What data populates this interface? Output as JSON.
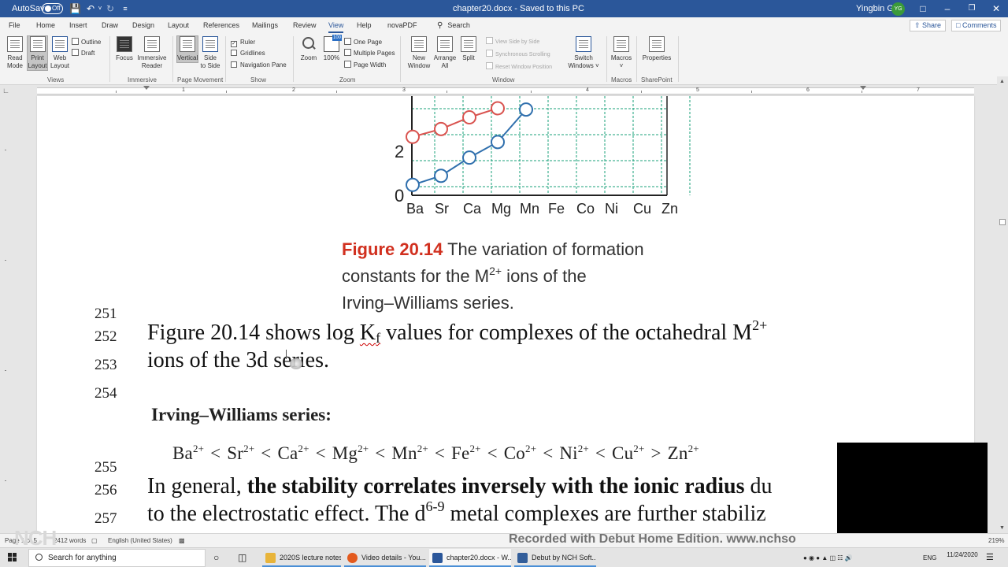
{
  "titlebar": {
    "autosave_label": "AutoSave",
    "autosave_state": "Off",
    "doc_title": "chapter20.docx  -  Saved to this PC",
    "user_name": "Yingbin Ge",
    "user_initials": "YG"
  },
  "tabs": [
    "File",
    "Home",
    "Insert",
    "Draw",
    "Design",
    "Layout",
    "References",
    "Mailings",
    "Review",
    "View",
    "Help",
    "novaPDF"
  ],
  "active_tab": "View",
  "search_label": "Search",
  "share_label": "Share",
  "comments_label": "Comments",
  "ribbon": {
    "views": {
      "read_mode": "Read\nMode",
      "print_layout": "Print\nLayout",
      "web_layout": "Web\nLayout",
      "outline": "Outline",
      "draft": "Draft",
      "label": "Views"
    },
    "immersive": {
      "focus": "Focus",
      "immersive_reader": "Immersive\nReader",
      "label": "Immersive"
    },
    "page_movement": {
      "vertical": "Vertical",
      "side_to_side": "Side\nto Side",
      "label": "Page Movement"
    },
    "show": {
      "ruler": "Ruler",
      "gridlines": "Gridlines",
      "navigation_pane": "Navigation Pane",
      "label": "Show"
    },
    "zoom": {
      "zoom": "Zoom",
      "hundred": "100%",
      "one_page": "One Page",
      "multiple_pages": "Multiple Pages",
      "page_width": "Page Width",
      "label": "Zoom"
    },
    "window": {
      "new_window": "New\nWindow",
      "arrange_all": "Arrange\nAll",
      "split": "Split",
      "view_side_by_side": "View Side by Side",
      "synchronous_scrolling": "Synchronous Scrolling",
      "reset_window_position": "Reset Window Position",
      "switch_windows": "Switch\nWindows ˅",
      "label": "Window"
    },
    "macros": {
      "macros": "Macros\n˅",
      "label": "Macros"
    },
    "sharepoint": {
      "properties": "Properties",
      "label": "SharePoint"
    }
  },
  "ruler_numbers": [
    "1",
    "2",
    "3",
    "4",
    "5",
    "6",
    "7"
  ],
  "chart_data": {
    "type": "line",
    "categories": [
      "Ba",
      "Sr",
      "Ca",
      "Mg",
      "Mn",
      "Fe",
      "Co",
      "Ni",
      "Cu",
      "Zn"
    ],
    "y_tick_labels": [
      "2",
      "0"
    ],
    "series": [
      {
        "color": "#d9534f",
        "values": [
          2.25,
          2.55,
          3.0,
          3.35,
          null,
          null,
          null,
          null,
          null,
          null
        ]
      },
      {
        "color": "#2f6fad",
        "values": [
          0.4,
          0.75,
          1.45,
          2.05,
          3.3,
          null,
          null,
          null,
          null,
          null
        ]
      }
    ],
    "grid": true,
    "grid_color": "#1aa07a"
  },
  "figure_caption": {
    "number": "Figure 20.14",
    "line1": "The variation of formation",
    "line2_pre": "constants for the M",
    "line2_sup": "2+",
    "line2_post": " ions of the",
    "line3": "Irving–Williams series."
  },
  "lines": [
    {
      "num": "251",
      "text": ""
    },
    {
      "num": "252",
      "pre": "Figure 20.14 shows log ",
      "kf_main": "K",
      "kf_sub": "f",
      "post": " values for complexes of the octahedral M",
      "sup": "2+"
    },
    {
      "num": "253",
      "text": "ions of the 3d series."
    },
    {
      "num": "254",
      "text": ""
    },
    {
      "num": "255",
      "text": ""
    },
    {
      "num": "256",
      "pre": "In general, ",
      "bold": "the stability correlates inversely with the ionic radius",
      "post": " du"
    },
    {
      "num": "257",
      "pre": "to the electrostatic effect. The d",
      "sup": "6-9",
      "post": " metal complexes are further stabiliz"
    }
  ],
  "iw_heading": "Irving–Williams series:",
  "iw_series": [
    {
      "ion": "Ba",
      "op": "<"
    },
    {
      "ion": "Sr",
      "op": "<"
    },
    {
      "ion": "Ca",
      "op": "<"
    },
    {
      "ion": "Mg",
      "op": "<"
    },
    {
      "ion": "Mn",
      "op": "<"
    },
    {
      "ion": "Fe",
      "op": "<"
    },
    {
      "ion": "Co",
      "op": "<"
    },
    {
      "ion": "Ni",
      "op": "<"
    },
    {
      "ion": "Cu",
      "op": ">"
    },
    {
      "ion": "Zn",
      "op": ""
    }
  ],
  "iw_charge": "2+",
  "statusbar": {
    "page_info": "Page 1 of 5",
    "words": "2412 words",
    "language": "English (United States)",
    "zoom_pct": "219%"
  },
  "watermark": "Recorded with Debut Home Edition. www.nchso",
  "nch_logo": "NCH",
  "taskbar": {
    "search_placeholder": "Search for anything",
    "apps": [
      {
        "label": "2020S lecture notes",
        "color": "#e8b43a"
      },
      {
        "label": "Video details - You...",
        "color": "#e35a1e"
      },
      {
        "label": "chapter20.docx - W...",
        "color": "#2b579a"
      },
      {
        "label": "Debut by NCH Soft...",
        "color": "#335e9a"
      }
    ],
    "lang": "ENG",
    "time": "",
    "date": "11/24/2020"
  }
}
